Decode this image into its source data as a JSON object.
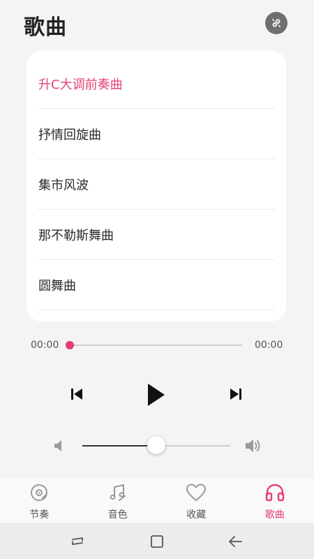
{
  "header": {
    "title": "歌曲"
  },
  "songs": [
    {
      "title": "升C大调前奏曲",
      "active": true
    },
    {
      "title": "抒情回旋曲",
      "active": false
    },
    {
      "title": "集市风波",
      "active": false
    },
    {
      "title": "那不勒斯舞曲",
      "active": false
    },
    {
      "title": "圆舞曲",
      "active": false
    }
  ],
  "player": {
    "current_time": "00:00",
    "total_time": "00:00",
    "progress": 0,
    "volume": 0.5
  },
  "tabs": [
    {
      "label": "节奏",
      "icon": "rhythm-icon",
      "active": false
    },
    {
      "label": "音色",
      "icon": "music-note-icon",
      "active": false
    },
    {
      "label": "收藏",
      "icon": "heart-icon",
      "active": false
    },
    {
      "label": "歌曲",
      "icon": "headphones-icon",
      "active": true
    }
  ],
  "colors": {
    "accent": "#e43d6f",
    "icon_gray": "#999999",
    "background": "#f4f4f4"
  }
}
